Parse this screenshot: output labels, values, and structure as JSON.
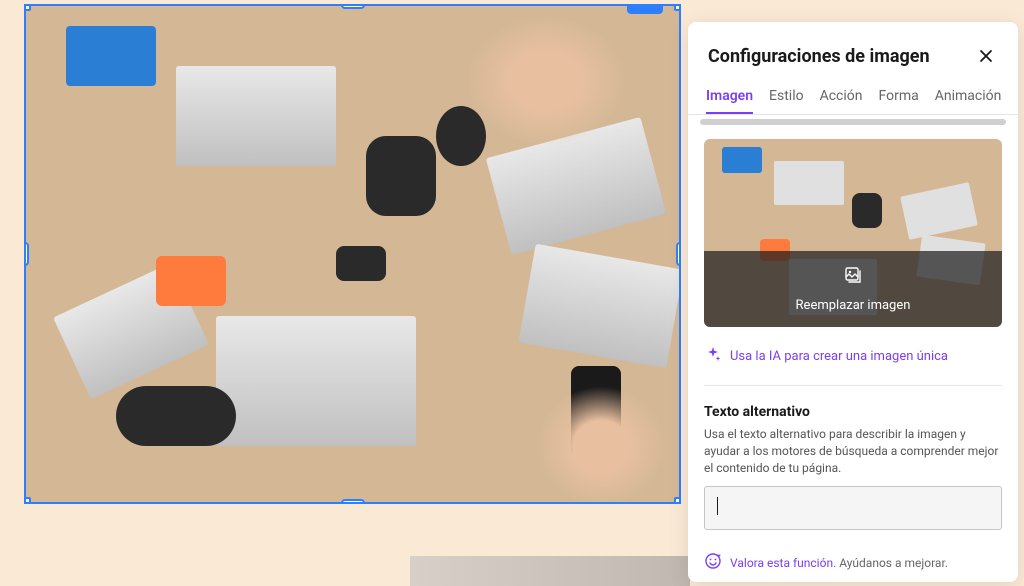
{
  "panel": {
    "title": "Configuraciones de imagen",
    "tabs": [
      {
        "label": "Imagen",
        "active": true
      },
      {
        "label": "Estilo",
        "active": false
      },
      {
        "label": "Acción",
        "active": false
      },
      {
        "label": "Forma",
        "active": false
      },
      {
        "label": "Animación",
        "active": false
      }
    ],
    "replace_label": "Reemplazar imagen",
    "ai_label": "Usa la IA para crear una imagen única",
    "alt_text": {
      "title": "Texto alternativo",
      "description": "Usa el texto alternativo para describir la imagen y ayudar a los motores de búsqueda a comprender mejor el contenido de tu página.",
      "value": ""
    },
    "feedback": {
      "link_text": "Valora esta función.",
      "rest_text": " Ayúdanos a mejorar."
    }
  }
}
